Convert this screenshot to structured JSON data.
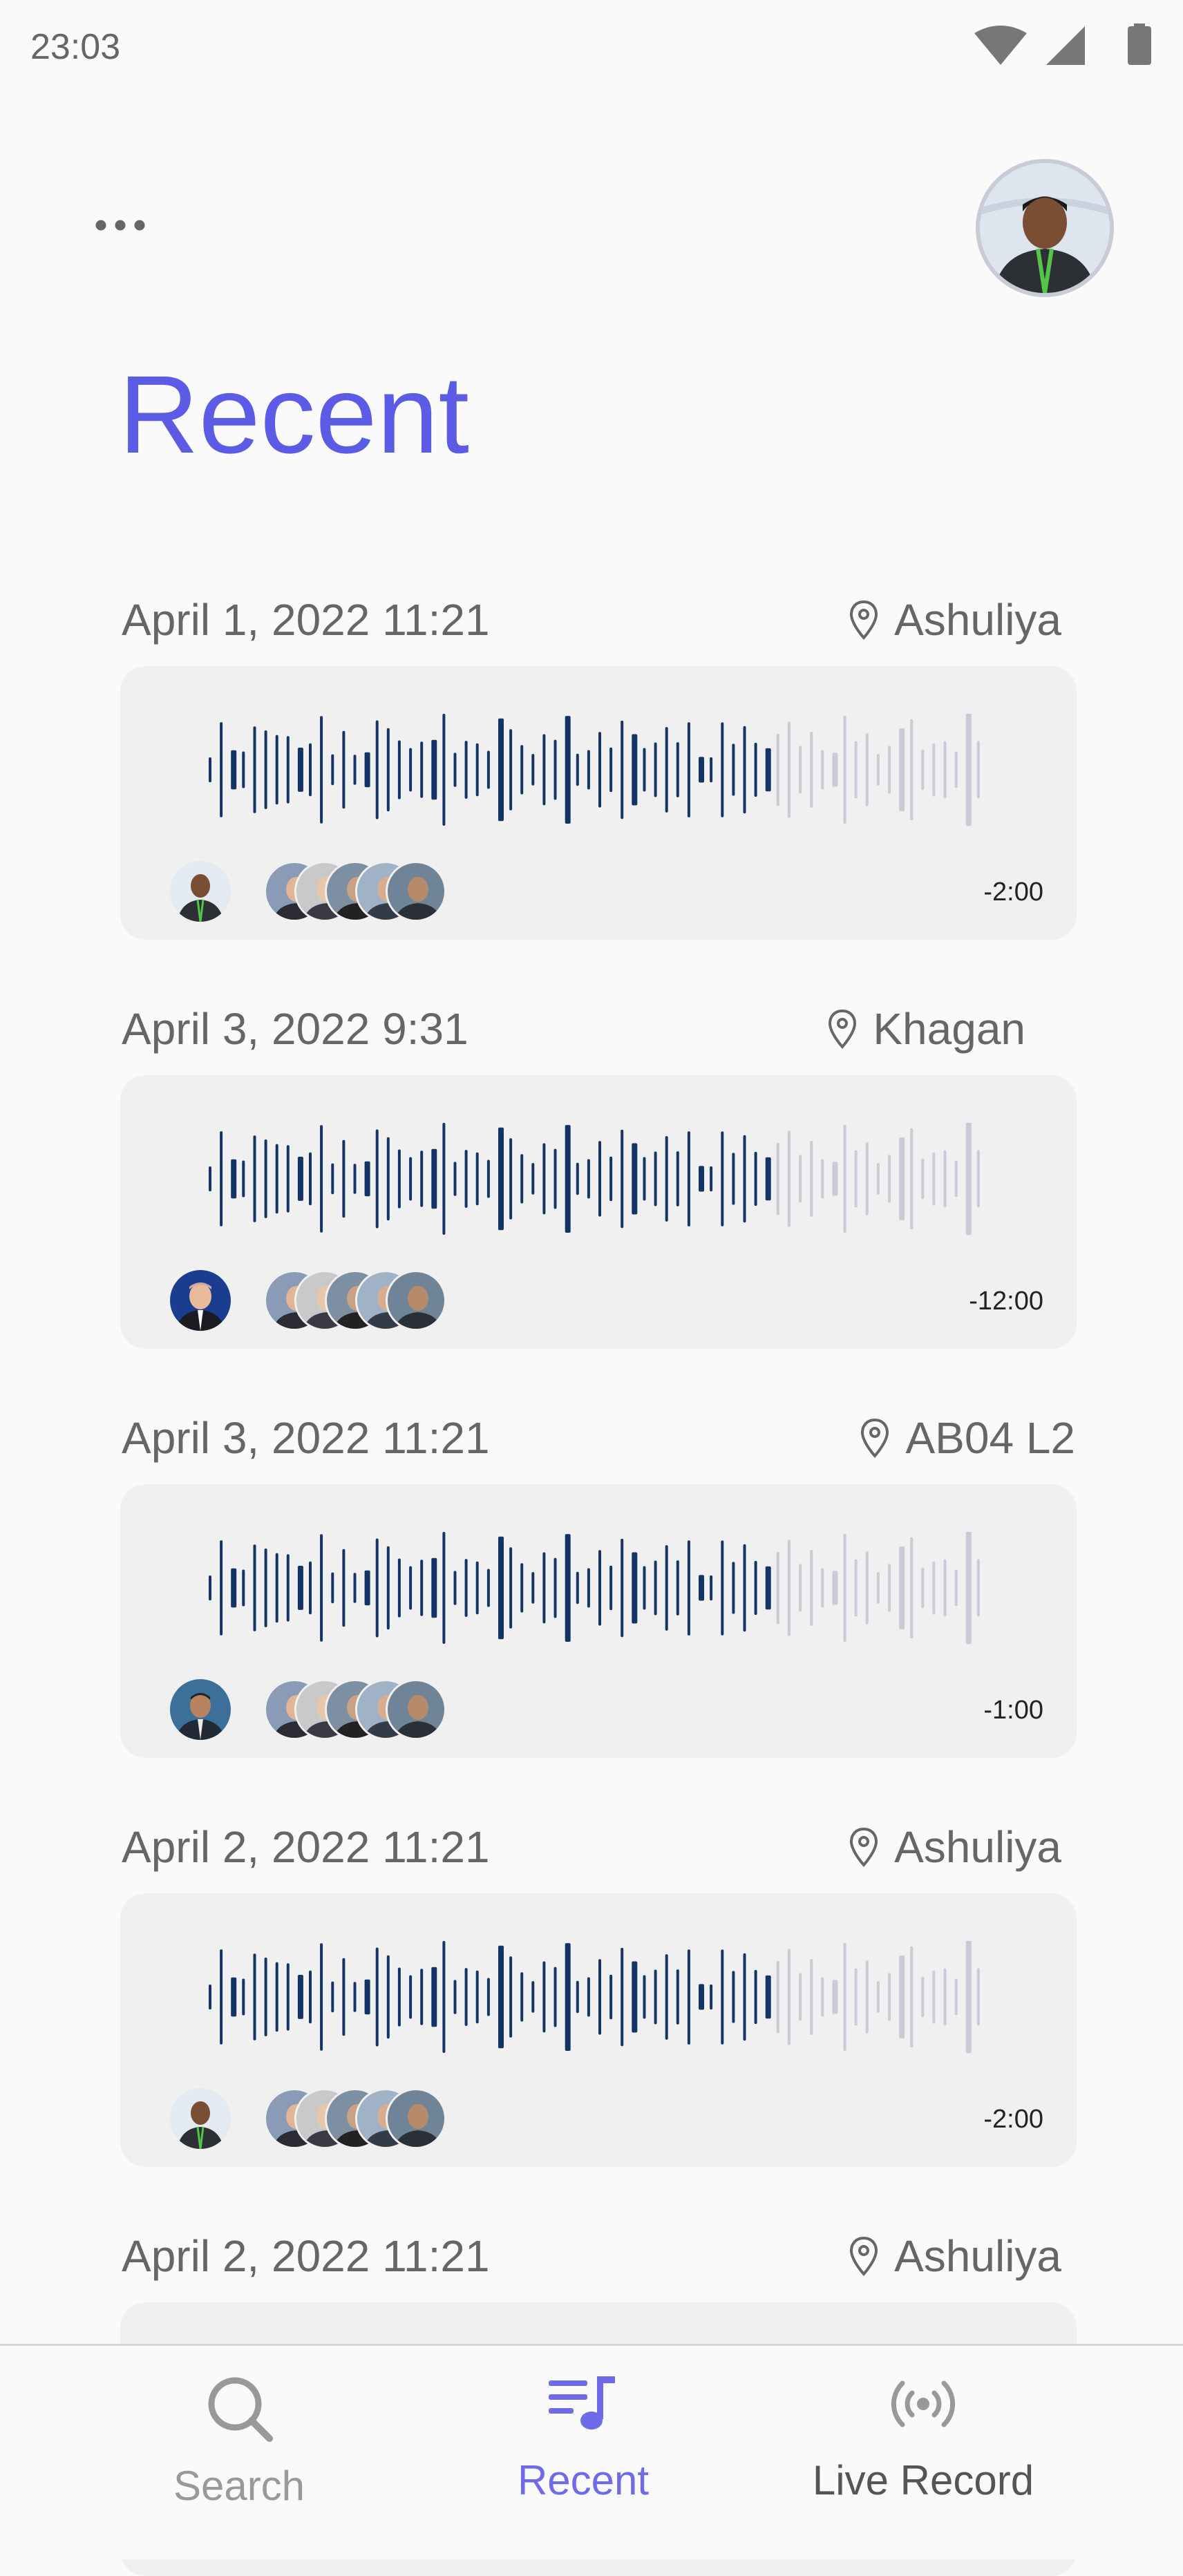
{
  "status_bar": {
    "time": "23:03"
  },
  "header": {
    "title": "Recent",
    "more_icon": "more-horizontal-icon",
    "avatar": "user-avatar"
  },
  "colors": {
    "accent": "#5b5be6",
    "wave_played": "#143466",
    "wave_unplayed": "#c9cbd6",
    "card_bg": "#f0f0f1",
    "text_muted": "#666666"
  },
  "recordings": [
    {
      "date": "April 1, 2022 11:21",
      "location": "Ashuliya",
      "duration": "-2:00"
    },
    {
      "date": "April 3, 2022 9:31",
      "location": "Khagan",
      "duration": "-12:00"
    },
    {
      "date": "April 3, 2022 11:21",
      "location": "AB04 L2",
      "duration": "-1:00"
    },
    {
      "date": "April 2, 2022 11:21",
      "location": "Ashuliya",
      "duration": "-2:00"
    },
    {
      "date": "April 2, 2022 11:21",
      "location": "Ashuliya"
    }
  ],
  "nav": {
    "search_label": "Search",
    "recent_label": "Recent",
    "live_label": "Live Record",
    "search_icon": "search-icon",
    "recent_icon": "playlist-music-icon",
    "live_icon": "broadcast-icon"
  }
}
